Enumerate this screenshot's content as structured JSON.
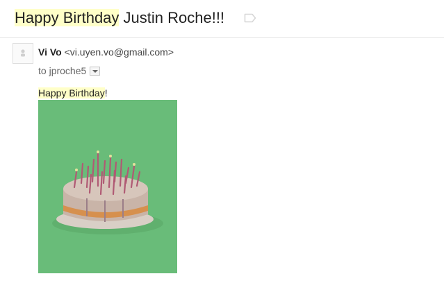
{
  "subject": {
    "highlight": "Happy Birthday",
    "rest": " Justin Roche!!!"
  },
  "message": {
    "sender_name": "Vi Vo",
    "sender_email": "<vi.uyen.vo@gmail.com>",
    "to_prefix": "to",
    "recipient": "jproche5",
    "body_highlight": "Happy Birthday",
    "body_rest": "!"
  },
  "icons": {
    "label": "label-tag-icon",
    "avatar": "default-avatar-icon",
    "details": "chevron-down-icon"
  },
  "colors": {
    "search_highlight": "#ffffc8",
    "image_background": "#6cc07c"
  }
}
